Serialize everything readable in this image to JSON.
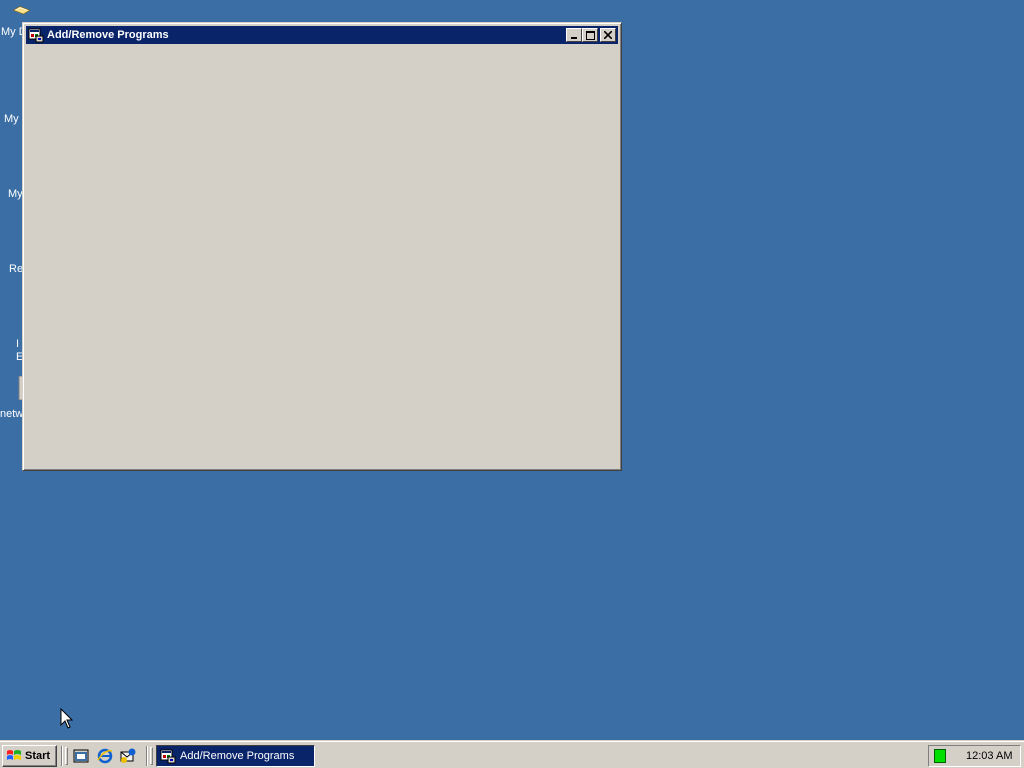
{
  "desktop": {
    "icons": [
      {
        "label": "My D",
        "icon": "my-documents-icon"
      },
      {
        "label": "My",
        "icon": "my-computer-icon"
      },
      {
        "label": "My",
        "icon": "my-network-places-icon"
      },
      {
        "label": "Re",
        "icon": "recycle-bin-icon"
      },
      {
        "label": "I",
        "label2": "E",
        "icon": "internet-explorer-icon"
      },
      {
        "label": "netw",
        "icon": "network-shortcut-icon"
      }
    ]
  },
  "window": {
    "title": "Add/Remove Programs",
    "icon": "add-remove-programs-icon",
    "buttons": {
      "minimize": "minimize-icon",
      "maximize": "maximize-icon",
      "close": "close-icon"
    }
  },
  "taskbar": {
    "start_label": "Start",
    "quick_launch": [
      {
        "name": "show-desktop-icon"
      },
      {
        "name": "internet-explorer-icon"
      },
      {
        "name": "outlook-express-icon"
      }
    ],
    "tasks": [
      {
        "label": "Add/Remove Programs",
        "active": true
      }
    ],
    "tray": {
      "clock": "12:03 AM",
      "network_status_color": "#00e000"
    }
  },
  "colors": {
    "desktop": "#3a6ea5",
    "titlebar": "#0a246a",
    "face": "#d4d0c8"
  }
}
